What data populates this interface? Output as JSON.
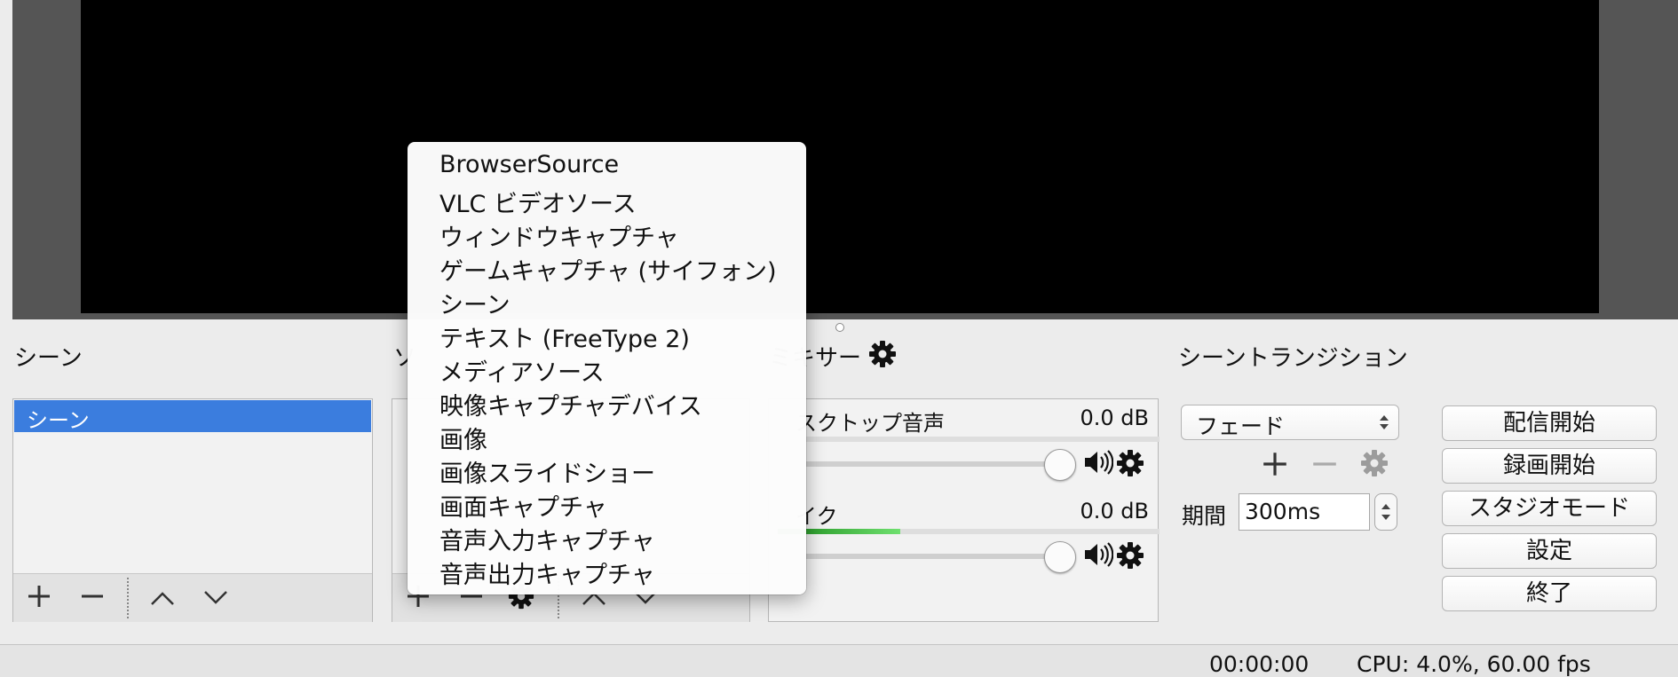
{
  "panels": {
    "scenes_title": "シーン",
    "sources_title": "ソ",
    "mixer_title": "ミキサー",
    "transitions_title": "シーントランジション"
  },
  "scenes": {
    "items": [
      "シーン"
    ],
    "selected_index": 0
  },
  "mixer": {
    "channels": [
      {
        "label": "デスクトップ音声",
        "visible_label": "スクトップ音声",
        "db": "0.0 dB",
        "level": 0.0,
        "volume": 1.0
      },
      {
        "label": "マイク",
        "visible_label": "イク",
        "db": "0.0 dB",
        "level": 0.32,
        "volume": 1.0
      }
    ]
  },
  "transitions": {
    "selected": "フェード",
    "duration_label": "期間",
    "duration_value": "300ms"
  },
  "controls": {
    "start_streaming": "配信開始",
    "start_recording": "録画開始",
    "studio_mode": "スタジオモード",
    "settings": "設定",
    "exit": "終了"
  },
  "status": {
    "time": "00:00:00",
    "cpu": "CPU: 4.0%, 60.00 fps"
  },
  "menu": {
    "items": [
      "BrowserSource",
      "VLC ビデオソース",
      "ウィンドウキャプチャ",
      "ゲームキャプチャ (サイフォン)",
      "シーン",
      "テキスト (FreeType 2)",
      "メディアソース",
      "映像キャプチャデバイス",
      "画像",
      "画像スライドショー",
      "画面キャプチャ",
      "音声入力キャプチャ",
      "音声出力キャプチャ"
    ]
  },
  "colors": {
    "selection": "#3b7dde",
    "meter_green": "#3cc23c"
  },
  "icons": [
    "plus-icon",
    "minus-icon",
    "chevron-up-icon",
    "chevron-down-icon",
    "gear-icon",
    "speaker-icon",
    "select-arrows-icon",
    "stepper-arrows-icon"
  ]
}
